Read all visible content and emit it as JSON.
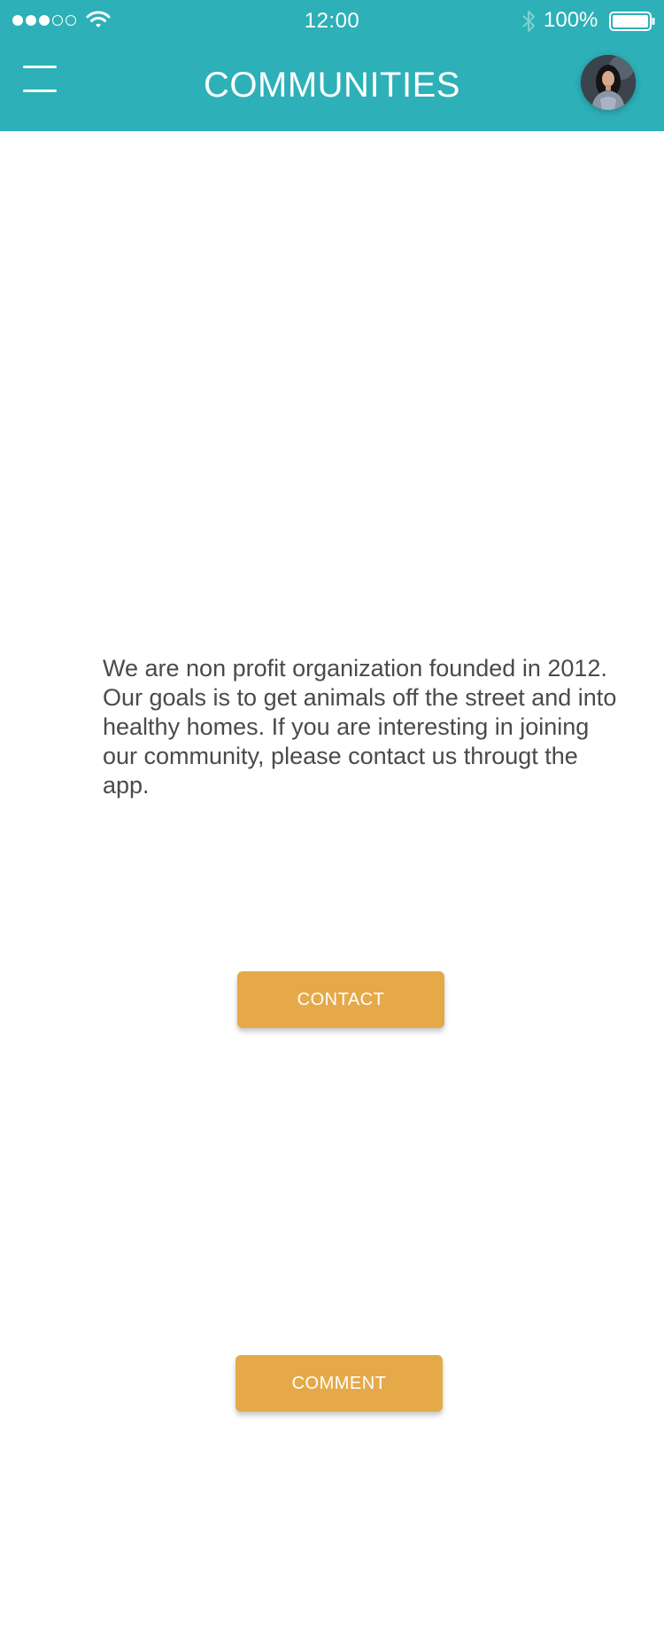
{
  "status_bar": {
    "time": "12:00",
    "battery_percent": "100%",
    "signal_dots": {
      "filled": 3,
      "total": 5
    },
    "icons": [
      "signal-dots",
      "wifi-icon",
      "bluetooth-icon",
      "battery-icon"
    ]
  },
  "header": {
    "title": "COMMUNITIES",
    "menu_icon": "hamburger-menu-icon",
    "avatar": "user-avatar",
    "background_color": "#2db0b8"
  },
  "main": {
    "faint_heading": "",
    "description": "We are non profit organization founded in 2012. Our goals is to get animals off the street and into healthy homes. If you are interesting in joining our community, please contact us througt the app.",
    "buttons": {
      "contact_label": "CONTACT",
      "comment_label": "COMMENT"
    },
    "button_color": "#e5a94a"
  }
}
